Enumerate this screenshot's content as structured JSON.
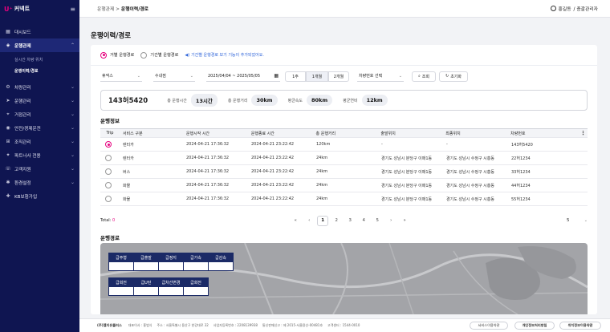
{
  "app": {
    "logo_mark": "U⁺",
    "logo_text": "커넥트"
  },
  "sidebar": {
    "items": [
      {
        "label": "대시보드",
        "icon": "grid-icon"
      },
      {
        "label": "운행관제",
        "icon": "gear-icon",
        "active": true
      },
      {
        "label": "차량관리",
        "icon": "car-icon"
      },
      {
        "label": "운행관리",
        "icon": "send-icon"
      },
      {
        "label": "거점관리",
        "icon": "pin-icon"
      },
      {
        "label": "안전/경제운전",
        "icon": "shield-icon"
      },
      {
        "label": "조직관리",
        "icon": "org-icon"
      },
      {
        "label": "파트너사 전용",
        "icon": "handshake-icon"
      },
      {
        "label": "고객지원",
        "icon": "headset-icon"
      },
      {
        "label": "환경설정",
        "icon": "settings-icon"
      },
      {
        "label": "KB보험가입",
        "icon": "plus-icon"
      }
    ],
    "sub_items": [
      {
        "label": "실시간 차량 위치"
      },
      {
        "label": "운행이력/경로",
        "active": true
      }
    ]
  },
  "topbar": {
    "breadcrumb_parent": "운행관제 >",
    "breadcrumb_current": "운행이력/경로",
    "user_name": "홍길동",
    "user_role": "/ 총괄관리자"
  },
  "page": {
    "title": "운행이력/경로"
  },
  "mode": {
    "option_trip": "거별 운행경로",
    "option_period": "기간별 운행경로",
    "notice": "기간별 운행경로 보기 기능이 추가되었어요."
  },
  "filters": {
    "company": "휴넥스",
    "dept": "수내점",
    "date_range": "2025/04/04 ~ 2025/05/05",
    "period_1w": "1주",
    "period_1m": "1개월",
    "period_2m": "2개월",
    "plate_select": "차량번호 선택",
    "search": "조회",
    "reset": "초기화"
  },
  "summary": {
    "plate": "143허5420",
    "total_time_label": "총 운행시간",
    "total_time": "13시간",
    "total_distance_label": "총 운행거리",
    "total_distance": "30km",
    "avg_speed_label": "평균속도",
    "avg_speed": "80km",
    "avg_fuel_label": "평균연비",
    "avg_fuel": "12km"
  },
  "trip_info": {
    "title": "운행정보",
    "columns": [
      "Trip",
      "서비스 구분",
      "운행시작 시간",
      "운행종료 시간",
      "총 운행거리",
      "출발위치",
      "최종위치",
      "차량번호"
    ],
    "rows": [
      {
        "service": "렌터카",
        "start": "2024-04-21 17:36:32",
        "end": "2024-04-21 23:22:42",
        "distance": "120km",
        "from": "-",
        "to": "-",
        "plate": "143허5420",
        "selected": true
      },
      {
        "service": "렌터카",
        "start": "2024-04-21 17:36:32",
        "end": "2024-04-21 23:22:42",
        "distance": "24km",
        "from": "경기도 성남시 분당구 이매1동",
        "to": "경기도 성남시 수정구 시흥동",
        "plate": "22허1234",
        "selected": false
      },
      {
        "service": "버스",
        "start": "2024-04-21 17:36:32",
        "end": "2024-04-21 23:22:42",
        "distance": "24km",
        "from": "경기도 성남시 분당구 이매1동",
        "to": "경기도 성남시 수정구 시흥동",
        "plate": "33허1234",
        "selected": false
      },
      {
        "service": "화물",
        "start": "2024-04-21 17:36:32",
        "end": "2024-04-21 23:22:42",
        "distance": "24km",
        "from": "경기도 성남시 분당구 이매1동",
        "to": "경기도 성남시 수정구 시흥동",
        "plate": "44허1234",
        "selected": false
      },
      {
        "service": "화물",
        "start": "2024-04-21 17:36:32",
        "end": "2024-04-21 23:22:42",
        "distance": "24km",
        "from": "경기도 성남시 분당구 이매1동",
        "to": "경기도 성남시 수정구 시흥동",
        "plate": "55허1234",
        "selected": false
      }
    ],
    "total_label": "Total:",
    "total_value": "0",
    "pages": [
      "1",
      "2",
      "3",
      "4",
      "5"
    ],
    "current_page": "1",
    "page_size": "5"
  },
  "route": {
    "title": "운행경로",
    "signals_row1": [
      "급주형",
      "급출발",
      "급정지",
      "급가속",
      "급감속"
    ],
    "signals_row2": [
      "급회전",
      "급U턴",
      "급차선변경",
      "급회전"
    ]
  },
  "footer": {
    "company": "(주)엘지유플러스",
    "ceo": "대표이사 : 홍범식",
    "address": "주소 : 서울특별시 용산구 한강대로 32",
    "biz_no": "사업자등록번호 : 2208139938",
    "telecom": "통신판매신고 : 제 2015-서울용산-00481호",
    "phone": "고객센터 : 1544-0010",
    "terms": "서비스이용약관",
    "privacy": "개인정보처리방침",
    "location_terms": "위치정보이용약관"
  },
  "colors": {
    "sidebar_bg": "#0f1551",
    "accent": "#e6007e",
    "notice": "#2b62d9"
  }
}
